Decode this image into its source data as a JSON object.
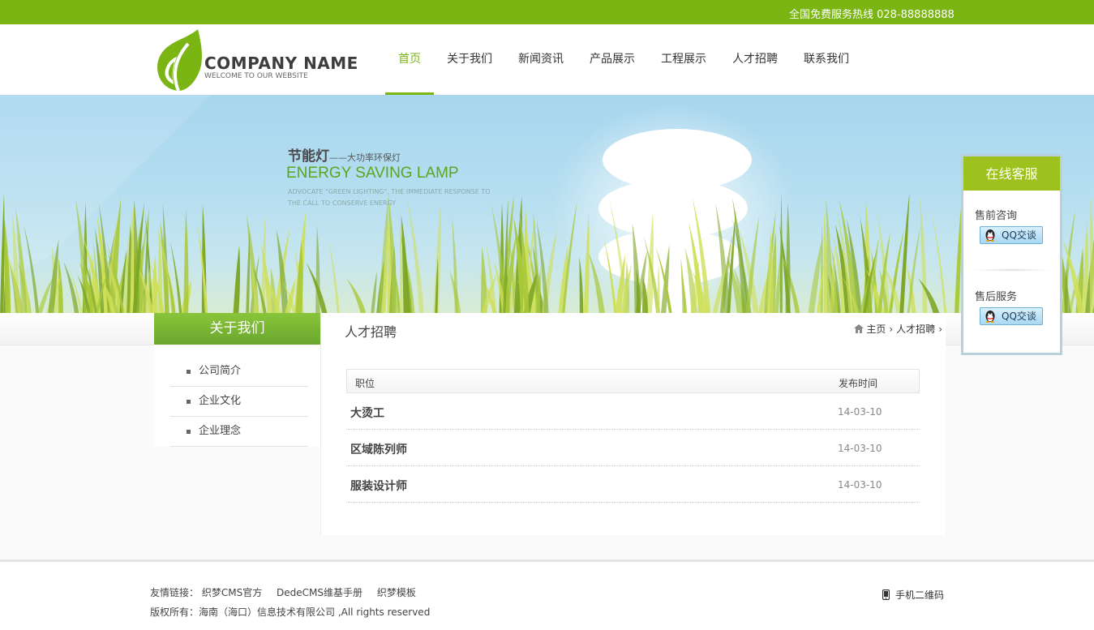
{
  "topbar": {
    "hotline": "全国免费服务热线 028-88888888"
  },
  "logo": {
    "name": "COMPANY NAME",
    "tagline": "WELCOME TO OUR WEBSITE"
  },
  "nav": {
    "items": [
      {
        "label": "首页",
        "active": true
      },
      {
        "label": "关于我们"
      },
      {
        "label": "新闻资讯"
      },
      {
        "label": "产品展示"
      },
      {
        "label": "工程展示"
      },
      {
        "label": "人才招聘"
      },
      {
        "label": "联系我们"
      }
    ]
  },
  "banner": {
    "title": "节能灯",
    "title_suffix": "——大功率环保灯",
    "title_en": "ENERGY SAVING LAMP",
    "subtitle": "ADVOCATE \"GREEN LIGHTING\", THE IMMEDIATE RESPONSE TO THE CALL TO CONSERVE ENERGY"
  },
  "sidebar": {
    "title": "关于我们",
    "items": [
      {
        "label": "公司简介"
      },
      {
        "label": "企业文化"
      },
      {
        "label": "企业理念"
      }
    ]
  },
  "main": {
    "title": "人才招聘",
    "breadcrumb": {
      "home": "主页",
      "current": "人才招聘"
    },
    "table": {
      "headers": {
        "position": "职位",
        "date": "发布时间"
      },
      "rows": [
        {
          "position": "大烫工",
          "date": "14-03-10"
        },
        {
          "position": "区域陈列师",
          "date": "14-03-10"
        },
        {
          "position": "服装设计师",
          "date": "14-03-10"
        }
      ]
    }
  },
  "service": {
    "title": "在线客服",
    "groups": [
      {
        "label": "售前咨询",
        "button": "QQ交谈"
      },
      {
        "label": "售后服务",
        "button": "QQ交谈"
      }
    ]
  },
  "footer": {
    "links_label": "友情链接：",
    "links": [
      "织梦CMS官方",
      "DedeCMS维基手册",
      "织梦模板"
    ],
    "copyright": "版权所有：海南（海口）信息技术有限公司 ,All rights reserved",
    "qr_label": "手机二维码"
  },
  "colors": {
    "brand": "#7ab514",
    "service_header": "#9dc21e"
  }
}
